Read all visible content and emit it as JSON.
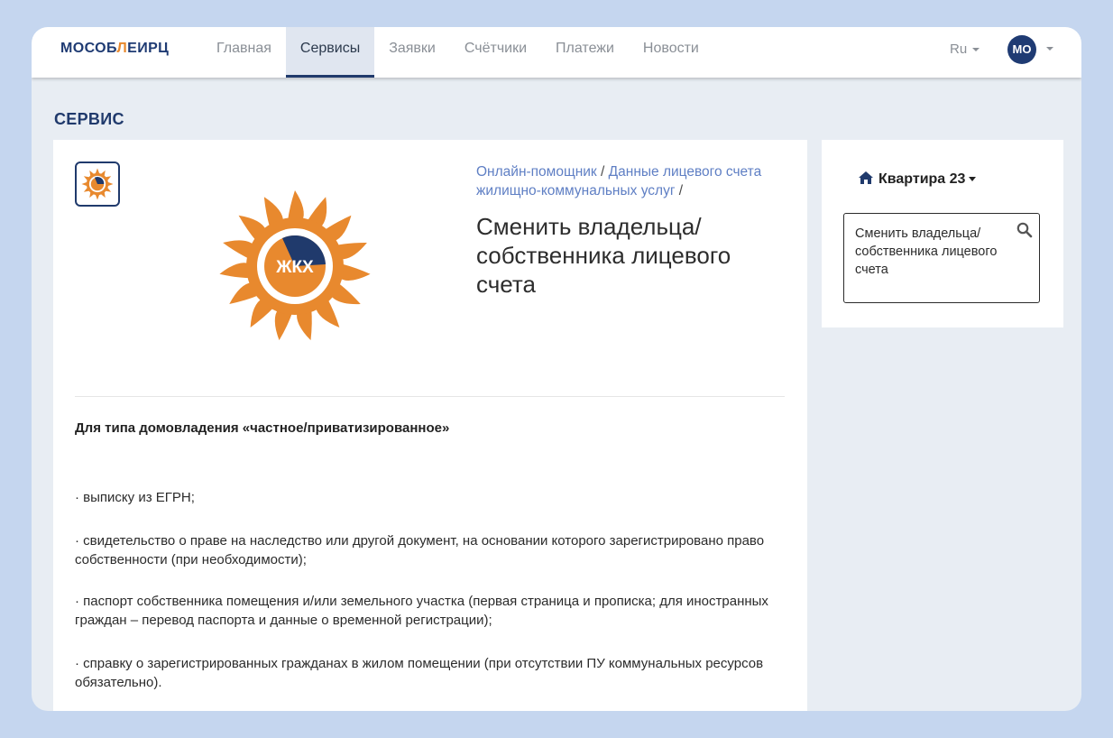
{
  "header": {
    "logo": {
      "part1": "МОСОБ",
      "part2": "Л",
      "part3": "ЕИРЦ"
    },
    "nav": [
      {
        "label": "Главная",
        "active": false
      },
      {
        "label": "Сервисы",
        "active": true
      },
      {
        "label": "Заявки",
        "active": false
      },
      {
        "label": "Счётчики",
        "active": false
      },
      {
        "label": "Платежи",
        "active": false
      },
      {
        "label": "Новости",
        "active": false
      }
    ],
    "language": "Ru",
    "user_initials": "МО"
  },
  "page": {
    "title": "СЕРВИС"
  },
  "service": {
    "logo_text": "ЖКХ",
    "breadcrumb": [
      {
        "label": "Онлайн-помощник"
      },
      {
        "label": "Данные лицевого счета жилищно-коммунальных услуг"
      }
    ],
    "breadcrumb_separator": "/",
    "title": "Сменить владельца/ собственника лицевого счета",
    "subheading": "Для типа домовладения «частное/приватизированное»",
    "items": [
      "· выписку из ЕГРН;",
      "· свидетельство о праве на наследство или другой документ, на основании которого зарегистрировано право собственности (при необходимости);",
      "· паспорт собственника помещения и/или земельного участка (первая страница и прописка; для иностранных граждан – перевод паспорта и данные о временной регистрации);",
      "· справку о зарегистрированных гражданах в жилом помещении (при отсутствии ПУ коммунальных ресурсов обязательно)."
    ]
  },
  "sidebar": {
    "apartment": "Квартира 23",
    "search_value": "Сменить владельца/ собственника лицевого счета"
  },
  "colors": {
    "brand_navy": "#203a6c",
    "brand_orange": "#e8892e",
    "link": "#5f7fc4",
    "background": "#e8edf3",
    "outer_background": "#c5d6ef"
  },
  "icons": {
    "home": "home-icon",
    "search": "search-icon",
    "caret": "chevron-down-icon",
    "service_logo": "zhkkh-sun-logo-icon"
  }
}
